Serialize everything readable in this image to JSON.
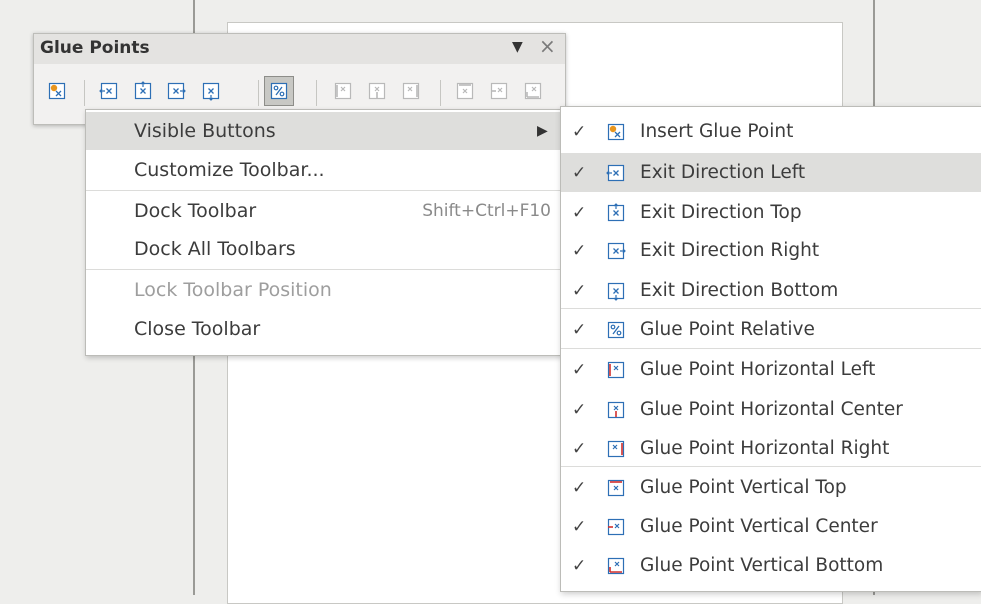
{
  "toolbar": {
    "title": "Glue Points",
    "menu_arrow": "▼",
    "close": "×",
    "icons": [
      {
        "name": "insert-glue-point-icon",
        "state": "normal"
      },
      {
        "name": "exit-direction-left-icon",
        "state": "normal"
      },
      {
        "name": "exit-direction-top-icon",
        "state": "normal"
      },
      {
        "name": "exit-direction-right-icon",
        "state": "normal"
      },
      {
        "name": "exit-direction-bottom-icon",
        "state": "normal"
      },
      {
        "name": "glue-point-relative-icon",
        "state": "active"
      },
      {
        "name": "glue-point-horizontal-left-icon",
        "state": "disabled"
      },
      {
        "name": "glue-point-horizontal-center-icon",
        "state": "disabled"
      },
      {
        "name": "glue-point-horizontal-right-icon",
        "state": "disabled"
      },
      {
        "name": "glue-point-vertical-top-icon",
        "state": "disabled"
      },
      {
        "name": "glue-point-vertical-center-icon",
        "state": "disabled"
      },
      {
        "name": "glue-point-vertical-bottom-icon",
        "state": "disabled"
      }
    ]
  },
  "context_menu": {
    "items": [
      {
        "label": "Visible Buttons",
        "accel": "",
        "has_submenu": true,
        "state": "hover"
      },
      {
        "label": "Customize Toolbar...",
        "accel": "",
        "has_submenu": false,
        "state": "normal"
      },
      {
        "label": "Dock Toolbar",
        "accel": "Shift+Ctrl+F10",
        "has_submenu": false,
        "state": "normal"
      },
      {
        "label": "Dock All Toolbars",
        "accel": "",
        "has_submenu": false,
        "state": "normal"
      },
      {
        "label": "Lock Toolbar Position",
        "accel": "",
        "has_submenu": false,
        "state": "disabled"
      },
      {
        "label": "Close Toolbar",
        "accel": "",
        "has_submenu": false,
        "state": "normal"
      }
    ],
    "submenu_arrow": "▶"
  },
  "visible_buttons_submenu": {
    "check_glyph": "✓",
    "items": [
      {
        "label": "Insert Glue Point",
        "checked": true,
        "icon": "insert-glue-point-icon"
      },
      {
        "label": "Exit Direction Left",
        "checked": true,
        "icon": "exit-direction-left-icon"
      },
      {
        "label": "Exit Direction Top",
        "checked": true,
        "icon": "exit-direction-top-icon"
      },
      {
        "label": "Exit Direction Right",
        "checked": true,
        "icon": "exit-direction-right-icon"
      },
      {
        "label": "Exit Direction Bottom",
        "checked": true,
        "icon": "exit-direction-bottom-icon"
      },
      {
        "label": "Glue Point Relative",
        "checked": true,
        "icon": "glue-point-relative-icon"
      },
      {
        "label": "Glue Point Horizontal Left",
        "checked": true,
        "icon": "glue-point-horizontal-left-icon"
      },
      {
        "label": "Glue Point Horizontal Center",
        "checked": true,
        "icon": "glue-point-horizontal-center-icon"
      },
      {
        "label": "Glue Point Horizontal Right",
        "checked": true,
        "icon": "glue-point-horizontal-right-icon"
      },
      {
        "label": "Glue Point Vertical Top",
        "checked": true,
        "icon": "glue-point-vertical-top-icon"
      },
      {
        "label": "Glue Point Vertical Center",
        "checked": true,
        "icon": "glue-point-vertical-center-icon"
      },
      {
        "label": "Glue Point Vertical Bottom",
        "checked": true,
        "icon": "glue-point-vertical-bottom-icon"
      }
    ]
  },
  "colors": {
    "icon_blue": "#2d6fb5",
    "icon_red": "#d2302d",
    "icon_orange": "#e8951e",
    "hover_bg": "#dededc",
    "disabled_icon": "#b9b9b9"
  }
}
